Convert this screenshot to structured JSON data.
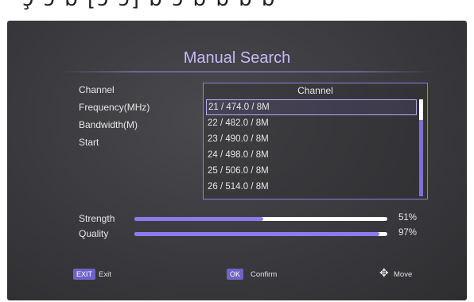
{
  "topbar_text": "ɔ̧ ɔ ɓ [ɔ ɔ] ɓ ɔ ɓ ɓ ɓ ɓ",
  "title": "Manual Search",
  "fields": {
    "channel": "Channel",
    "frequency": "Frequency(MHz)",
    "bandwidth": "Bandwidth(M)",
    "start": "Start"
  },
  "channel_list": {
    "header": "Channel",
    "items": [
      "21 / 474.0 / 8M",
      "22 / 482.0 / 8M",
      "23 / 490.0 / 8M",
      "24 / 498.0 / 8M",
      "25 / 506.0 / 8M",
      "26 / 514.0 / 8M"
    ],
    "selected_index": 0
  },
  "signal": {
    "strength": {
      "label": "Strength",
      "value": "51%",
      "fraction": 0.51
    },
    "quality": {
      "label": "Quality",
      "value": "97%",
      "fraction": 0.97
    }
  },
  "hints": {
    "exit_key": "EXIT",
    "exit_text": "Exit",
    "ok_key": "OK",
    "ok_text": "Confirm",
    "move_text": "Move"
  },
  "colors": {
    "accent": "#8c7bf0",
    "title": "#c9b8f7",
    "background": "#3a3a3e"
  }
}
